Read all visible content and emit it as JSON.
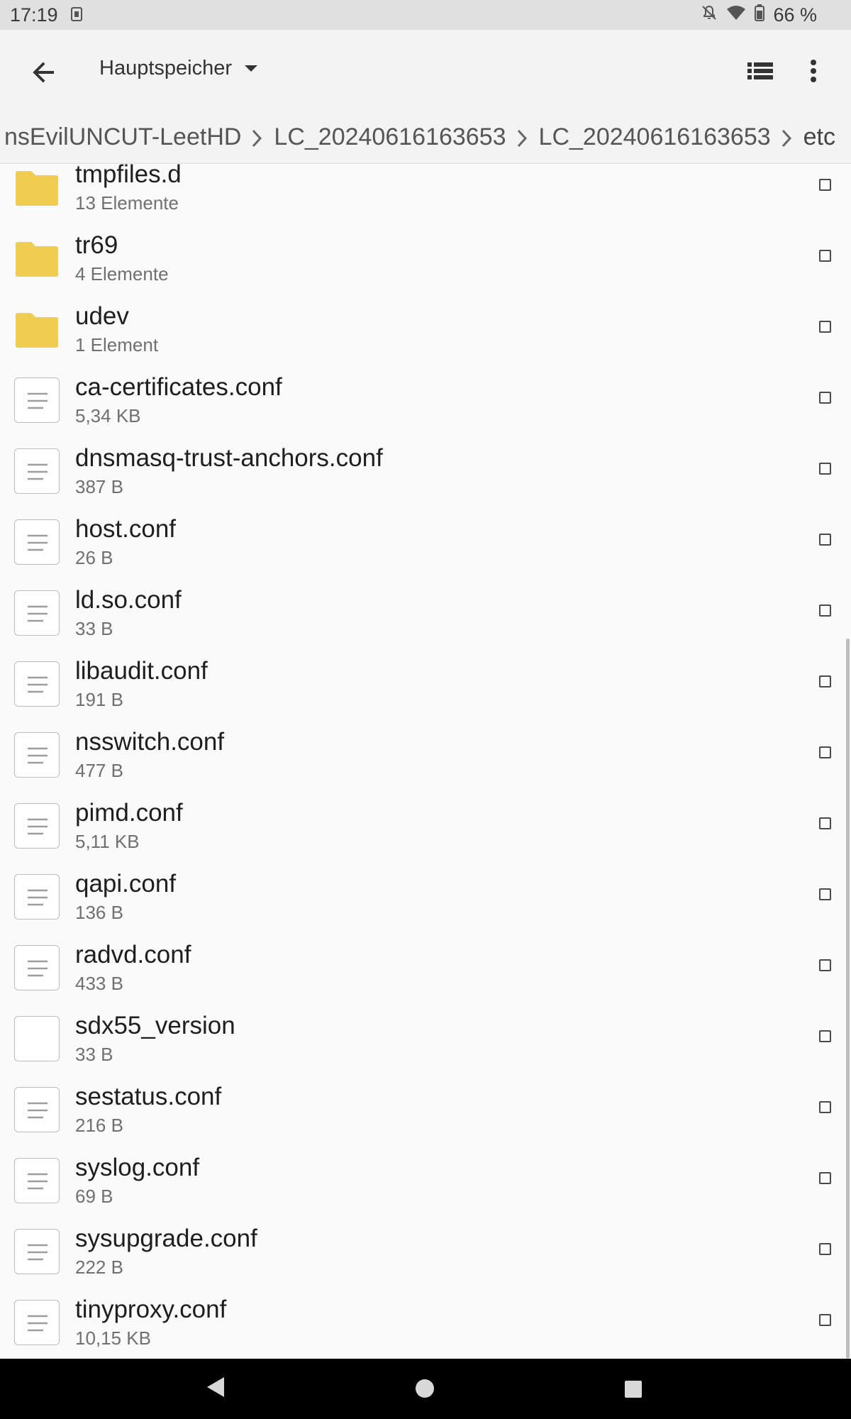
{
  "status_bar": {
    "time": "17:19",
    "battery": "66 %",
    "icons": [
      "sim-icon",
      "mute-icon",
      "wifi-icon",
      "battery-icon"
    ]
  },
  "app_bar": {
    "title": "Hauptspeicher",
    "icons": [
      "back-arrow-icon",
      "dropdown-arrow-icon",
      "list-view-icon",
      "more-vert-icon"
    ]
  },
  "breadcrumb": {
    "segments": [
      "nsEvilUNCUT-LeetHD",
      "LC_20240616163653",
      "LC_20240616163653",
      "etc"
    ]
  },
  "files": [
    {
      "name": "tmpfiles.d",
      "meta": "13 Elemente",
      "type": "folder"
    },
    {
      "name": "tr69",
      "meta": "4 Elemente",
      "type": "folder"
    },
    {
      "name": "udev",
      "meta": "1 Element",
      "type": "folder"
    },
    {
      "name": "ca-certificates.conf",
      "meta": "5,34 KB",
      "type": "text"
    },
    {
      "name": "dnsmasq-trust-anchors.conf",
      "meta": "387 B",
      "type": "text"
    },
    {
      "name": "host.conf",
      "meta": "26 B",
      "type": "text"
    },
    {
      "name": "ld.so.conf",
      "meta": "33 B",
      "type": "text"
    },
    {
      "name": "libaudit.conf",
      "meta": "191 B",
      "type": "text"
    },
    {
      "name": "nsswitch.conf",
      "meta": "477 B",
      "type": "text"
    },
    {
      "name": "pimd.conf",
      "meta": "5,11 KB",
      "type": "text"
    },
    {
      "name": "qapi.conf",
      "meta": "136 B",
      "type": "text"
    },
    {
      "name": "radvd.conf",
      "meta": "433 B",
      "type": "text"
    },
    {
      "name": "sdx55_version",
      "meta": "33 B",
      "type": "blank"
    },
    {
      "name": "sestatus.conf",
      "meta": "216 B",
      "type": "text"
    },
    {
      "name": "syslog.conf",
      "meta": "69 B",
      "type": "text"
    },
    {
      "name": "sysupgrade.conf",
      "meta": "222 B",
      "type": "text"
    },
    {
      "name": "tinyproxy.conf",
      "meta": "10,15 KB",
      "type": "text"
    }
  ],
  "colors": {
    "folder": "#f0cd50",
    "status_bar_bg": "#e0e0e0",
    "app_bar_bg": "#f3f3f3",
    "list_bg": "#fafafa",
    "nav_bar_bg": "#000000"
  },
  "nav_bar": {
    "icons": [
      "nav-back-icon",
      "nav-home-icon",
      "nav-recents-icon"
    ]
  }
}
